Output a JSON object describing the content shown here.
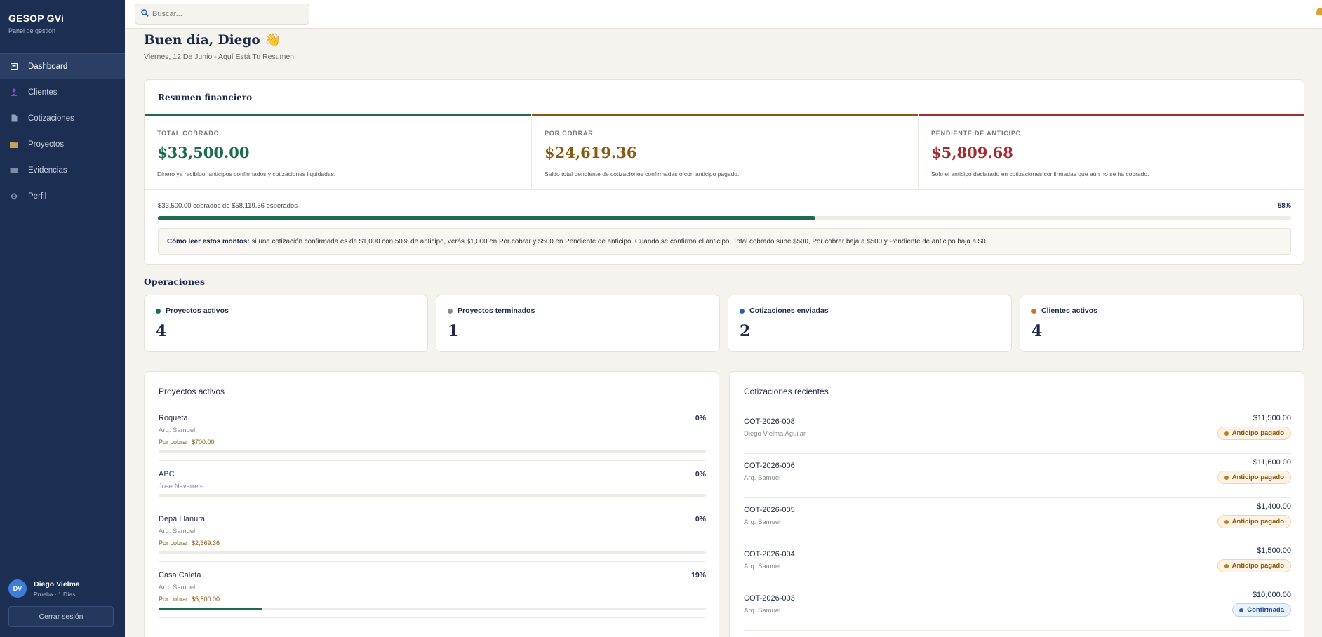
{
  "brand": {
    "title": "GESOP GVi",
    "subtitle": "Panel de gestión"
  },
  "nav": [
    {
      "label": "Dashboard",
      "icon": "dashboard-icon",
      "active": true
    },
    {
      "label": "Clientes",
      "icon": "user-icon"
    },
    {
      "label": "Cotizaciones",
      "icon": "document-icon"
    },
    {
      "label": "Proyectos",
      "icon": "folder-icon"
    },
    {
      "label": "Evidencias",
      "icon": "camera-icon"
    },
    {
      "label": "Perfil",
      "icon": "gear-icon"
    }
  ],
  "user": {
    "initials": "DV",
    "name": "Diego Vielma",
    "role": "Prueba · 1 Días",
    "logout": "Cerrar sesión"
  },
  "search": {
    "placeholder": "Buscar...",
    "value": ""
  },
  "greeting": {
    "title": "Buen día, Diego 👋",
    "subtitle": "Viernes, 12 De Junio - Aquí Está Tu Resumen"
  },
  "finance": {
    "title": "Resumen financiero",
    "kpis": [
      {
        "label": "TOTAL COBRADO",
        "value": "$33,500.00",
        "desc": "Dinero ya recibido: anticipos confirmados y cotizaciones liquidadas.",
        "color": "#1a6b52"
      },
      {
        "label": "POR COBRAR",
        "value": "$24,619.36",
        "desc": "Saldo total pendiente de cotizaciones confirmadas o con anticipo pagado.",
        "color": "#8a5a10"
      },
      {
        "label": "PENDIENTE DE ANTICIPO",
        "value": "$5,809.68",
        "desc": "Solo el anticipo declarado en cotizaciones confirmadas que aún no se ha cobrado.",
        "color": "#a82a2a"
      }
    ],
    "progress_text": "$33,500.00 cobrados de $58,119.36 esperados",
    "progress_pct_label": "58%",
    "progress_value": 0.58,
    "note_bold": "Cómo leer estos montos:",
    "note_text": "si una cotización confirmada es de $1,000 con 50% de anticipo, verás $1,000 en Por cobrar y $500 en Pendiente de anticipo. Cuando se confirma el anticipo, Total cobrado sube $500, Por cobrar baja a $500 y Pendiente de anticipo baja a $0."
  },
  "operations": {
    "title": "Operaciones",
    "cards": [
      {
        "label": "Proyectos activos",
        "value": "4",
        "color": "#1a6b52"
      },
      {
        "label": "Proyectos terminados",
        "value": "1",
        "color": "#8a8a8a"
      },
      {
        "label": "Cotizaciones enviadas",
        "value": "2",
        "color": "#2a5ea8"
      },
      {
        "label": "Clientes activos",
        "value": "4",
        "color": "#c07a20"
      }
    ]
  },
  "projects": {
    "title": "Proyectos activos",
    "items": [
      {
        "name": "Roqueta",
        "client": "Arq. Samuel",
        "due": "Por cobrar: $700.00",
        "pct_label": "0%",
        "progress": 0
      },
      {
        "name": "ABC",
        "client": "Jose Navarrete",
        "due": "",
        "pct_label": "0%",
        "progress": 0
      },
      {
        "name": "Depa Llanura",
        "client": "Arq. Samuel",
        "due": "Por cobrar: $2,369.36",
        "pct_label": "0%",
        "progress": 0
      },
      {
        "name": "Casa Caleta",
        "client": "Arq. Samuel",
        "due": "Por cobrar: $5,800.00",
        "pct_label": "19%",
        "progress": 0.19
      }
    ]
  },
  "quotes": {
    "title": "Cotizaciones recientes",
    "items": [
      {
        "id": "COT-2026-008",
        "client": "Diego Vielma Aguilar",
        "amount": "$11,500.00",
        "status": "Anticipo pagado",
        "kind": "paid"
      },
      {
        "id": "COT-2026-006",
        "client": "Arq. Samuel",
        "amount": "$11,600.00",
        "status": "Anticipo pagado",
        "kind": "paid"
      },
      {
        "id": "COT-2026-005",
        "client": "Arq. Samuel",
        "amount": "$1,400.00",
        "status": "Anticipo pagado",
        "kind": "paid"
      },
      {
        "id": "COT-2026-004",
        "client": "Arq. Samuel",
        "amount": "$1,500.00",
        "status": "Anticipo pagado",
        "kind": "paid"
      },
      {
        "id": "COT-2026-003",
        "client": "Arq. Samuel",
        "amount": "$10,000.00",
        "status": "Confirmada",
        "kind": "conf"
      }
    ]
  }
}
